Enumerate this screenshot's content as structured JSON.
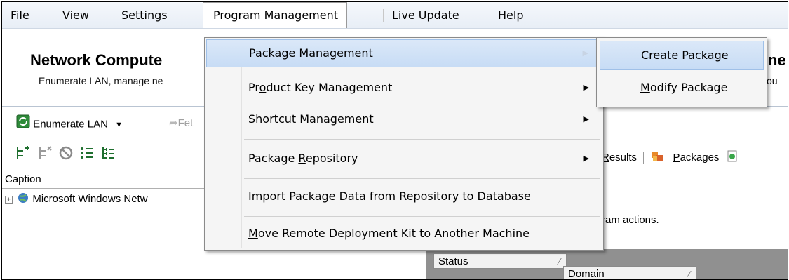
{
  "menubar": {
    "items": [
      {
        "pre": "",
        "u": "F",
        "post": "ile"
      },
      {
        "pre": "",
        "u": "V",
        "post": "iew"
      },
      {
        "pre": "",
        "u": "S",
        "post": "ettings"
      },
      {
        "pre": "",
        "u": "P",
        "post": "rogram Management"
      },
      {
        "pre": "",
        "u": "L",
        "post": "ive Update"
      },
      {
        "pre": "",
        "u": "H",
        "post": "elp"
      }
    ]
  },
  "header": {
    "title": "Network Compute",
    "subtitle": "Enumerate LAN, manage ne",
    "title_right": "ne",
    "subtitle_right": "ou"
  },
  "toolbar": {
    "enumerate": {
      "u": "E",
      "post": "numerate LAN"
    },
    "fetch": "Fet"
  },
  "tree": {
    "header": "Caption",
    "row": "Microsoft Windows Netw"
  },
  "right_pane": {
    "results": {
      "u": "R",
      "post": "esults"
    },
    "packages": {
      "u": "P",
      "post": "ackages"
    },
    "hint": "ram actions.",
    "grid_cols": [
      "Status",
      "Domain"
    ]
  },
  "dropdown": {
    "items": [
      {
        "pre": "",
        "u": "P",
        "post": "ackage Management",
        "arrow": true
      },
      {
        "pre": "Pr",
        "u": "o",
        "post": "duct Key Management",
        "arrow": true
      },
      {
        "pre": "",
        "u": "S",
        "post": "hortcut Management",
        "arrow": true
      },
      {
        "pre": "Package ",
        "u": "R",
        "post": "epository",
        "arrow": true
      },
      {
        "pre": "",
        "u": "I",
        "post": "mport Package Data from Repository to Database",
        "arrow": false
      },
      {
        "pre": "",
        "u": "M",
        "post": "ove Remote Deployment Kit to Another Machine",
        "arrow": false
      }
    ]
  },
  "submenu": {
    "items": [
      {
        "pre": "",
        "u": "C",
        "post": "reate Package"
      },
      {
        "pre": "",
        "u": "M",
        "post": "odify Package"
      }
    ]
  },
  "colors": {
    "highlight": "#c7dcf5",
    "menu_bg": "#f5f5f5",
    "grid_bg": "#909090"
  }
}
